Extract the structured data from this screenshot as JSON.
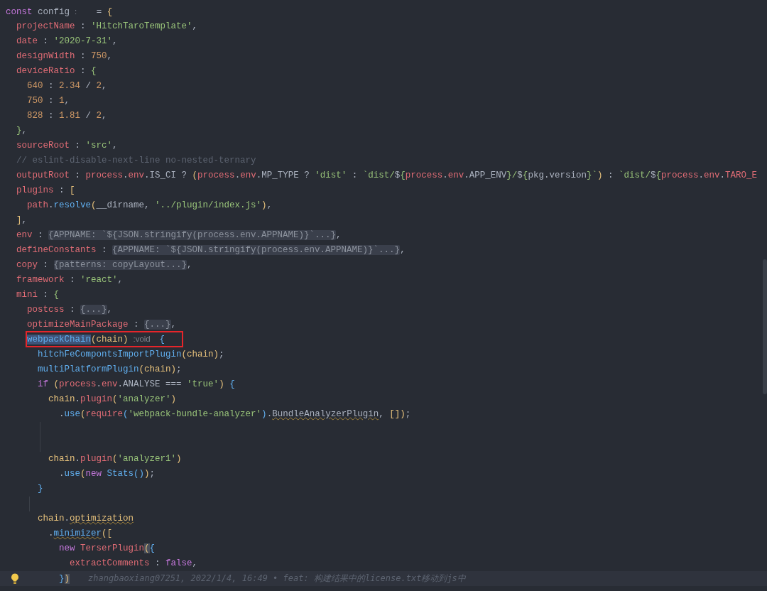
{
  "code_lines": [
    {
      "tokens": [
        {
          "kind": "kw",
          "text": "const"
        },
        {
          "kind": "p",
          "text": " config"
        },
        {
          "kind": "hint",
          "text": ":"
        },
        {
          "kind": "p",
          "text": "  = "
        },
        {
          "kind": "brk",
          "text": "{"
        }
      ],
      "children": [
        {
          "tokens": [
            {
              "kind": "prop",
              "text": "projectName"
            },
            {
              "kind": "p",
              "text": " : "
            },
            {
              "kind": "str",
              "text": "'HitchTaroTemplate'"
            },
            {
              "kind": "p",
              "text": ","
            }
          ]
        },
        {
          "tokens": [
            {
              "kind": "prop",
              "text": "date"
            },
            {
              "kind": "p",
              "text": " : "
            },
            {
              "kind": "str",
              "text": "'2020-7-31'"
            },
            {
              "kind": "p",
              "text": ","
            }
          ]
        },
        {
          "tokens": [
            {
              "kind": "prop",
              "text": "designWidth"
            },
            {
              "kind": "p",
              "text": " : "
            },
            {
              "kind": "num",
              "text": "750"
            },
            {
              "kind": "p",
              "text": ","
            }
          ]
        },
        {
          "tokens": [
            {
              "kind": "prop",
              "text": "deviceRatio"
            },
            {
              "kind": "p",
              "text": " : "
            },
            {
              "kind": "brg",
              "text": "{"
            }
          ],
          "children": [
            {
              "tokens": [
                {
                  "kind": "num",
                  "text": "640"
                },
                {
                  "kind": "p",
                  "text": " : "
                },
                {
                  "kind": "num",
                  "text": "2.34"
                },
                {
                  "kind": "p",
                  "text": " / "
                },
                {
                  "kind": "num",
                  "text": "2"
                },
                {
                  "kind": "p",
                  "text": ","
                }
              ]
            },
            {
              "tokens": [
                {
                  "kind": "num",
                  "text": "750"
                },
                {
                  "kind": "p",
                  "text": " : "
                },
                {
                  "kind": "num",
                  "text": "1"
                },
                {
                  "kind": "p",
                  "text": ","
                }
              ]
            },
            {
              "tokens": [
                {
                  "kind": "num",
                  "text": "828"
                },
                {
                  "kind": "p",
                  "text": " : "
                },
                {
                  "kind": "num",
                  "text": "1.81"
                },
                {
                  "kind": "p",
                  "text": " / "
                },
                {
                  "kind": "num",
                  "text": "2"
                },
                {
                  "kind": "p",
                  "text": ","
                }
              ]
            }
          ]
        },
        {
          "tokens": [
            {
              "kind": "brg",
              "text": "}"
            },
            {
              "kind": "p",
              "text": ","
            }
          ]
        },
        {
          "tokens": [
            {
              "kind": "prop",
              "text": "sourceRoot"
            },
            {
              "kind": "p",
              "text": " : "
            },
            {
              "kind": "str",
              "text": "'src'"
            },
            {
              "kind": "p",
              "text": ","
            }
          ]
        },
        {
          "tokens": [
            {
              "kind": "cmt",
              "text": "// eslint-disable-next-line no-nested-ternary"
            }
          ]
        },
        {
          "tokens": [
            {
              "kind": "prop",
              "text": "outputRoot"
            },
            {
              "kind": "p",
              "text": " : "
            },
            {
              "kind": "prop",
              "text": "process"
            },
            {
              "kind": "p",
              "text": "."
            },
            {
              "kind": "prop",
              "text": "env"
            },
            {
              "kind": "p",
              "text": ".IS_CI ? "
            },
            {
              "kind": "brk",
              "text": "("
            },
            {
              "kind": "prop",
              "text": "process"
            },
            {
              "kind": "p",
              "text": "."
            },
            {
              "kind": "prop",
              "text": "env"
            },
            {
              "kind": "p",
              "text": ".MP_TYPE ? "
            },
            {
              "kind": "str",
              "text": "'dist'"
            },
            {
              "kind": "p",
              "text": " : "
            },
            {
              "kind": "str",
              "text": "`dist/"
            },
            {
              "kind": "p",
              "text": "$"
            },
            {
              "kind": "brg",
              "text": "{"
            },
            {
              "kind": "prop",
              "text": "process"
            },
            {
              "kind": "p",
              "text": "."
            },
            {
              "kind": "prop",
              "text": "env"
            },
            {
              "kind": "p",
              "text": ".APP_ENV"
            },
            {
              "kind": "brg",
              "text": "}"
            },
            {
              "kind": "str",
              "text": "/"
            },
            {
              "kind": "p",
              "text": "$"
            },
            {
              "kind": "brg",
              "text": "{"
            },
            {
              "kind": "p",
              "text": "pkg.version"
            },
            {
              "kind": "brg",
              "text": "}"
            },
            {
              "kind": "str",
              "text": "`"
            },
            {
              "kind": "brk",
              "text": ")"
            },
            {
              "kind": "p",
              "text": " : "
            },
            {
              "kind": "str",
              "text": "`dist/"
            },
            {
              "kind": "p",
              "text": "$"
            },
            {
              "kind": "brg",
              "text": "{"
            },
            {
              "kind": "prop",
              "text": "process"
            },
            {
              "kind": "p",
              "text": "."
            },
            {
              "kind": "prop",
              "text": "env"
            },
            {
              "kind": "p",
              "text": "."
            },
            {
              "kind": "prop",
              "text": "TARO_E"
            }
          ]
        },
        {
          "tokens": [
            {
              "kind": "prop",
              "text": "plugins"
            },
            {
              "kind": "p",
              "text": " : "
            },
            {
              "kind": "brk",
              "text": "["
            }
          ],
          "children": [
            {
              "tokens": [
                {
                  "kind": "prop",
                  "text": "path"
                },
                {
                  "kind": "p",
                  "text": "."
                },
                {
                  "kind": "fn",
                  "text": "resolve"
                },
                {
                  "kind": "brk",
                  "text": "("
                },
                {
                  "kind": "p",
                  "text": "__dirname, "
                },
                {
                  "kind": "str",
                  "text": "'../plugin/index.js'"
                },
                {
                  "kind": "brk",
                  "text": ")"
                },
                {
                  "kind": "p",
                  "text": ","
                }
              ]
            }
          ]
        },
        {
          "tokens": [
            {
              "kind": "brk",
              "text": "]"
            },
            {
              "kind": "p",
              "text": ","
            }
          ]
        },
        {
          "tokens": [
            {
              "kind": "prop",
              "text": "env"
            },
            {
              "kind": "p",
              "text": " : "
            },
            {
              "kind": "fold",
              "text": "{APPNAME: `${JSON.stringify(process.env.APPNAME)}`...}"
            },
            {
              "kind": "p",
              "text": ","
            }
          ]
        },
        {
          "tokens": [
            {
              "kind": "prop",
              "text": "defineConstants"
            },
            {
              "kind": "p",
              "text": " : "
            },
            {
              "kind": "fold",
              "text": "{APPNAME: `${JSON.stringify(process.env.APPNAME)}`...}"
            },
            {
              "kind": "p",
              "text": ","
            }
          ]
        },
        {
          "tokens": [
            {
              "kind": "prop",
              "text": "copy"
            },
            {
              "kind": "p",
              "text": " : "
            },
            {
              "kind": "fold",
              "text": "{patterns: copyLayout...}"
            },
            {
              "kind": "p",
              "text": ","
            }
          ]
        },
        {
          "tokens": [
            {
              "kind": "prop",
              "text": "framework"
            },
            {
              "kind": "p",
              "text": " : "
            },
            {
              "kind": "str",
              "text": "'react'"
            },
            {
              "kind": "p",
              "text": ","
            }
          ]
        },
        {
          "tokens": [
            {
              "kind": "prop",
              "text": "mini"
            },
            {
              "kind": "p",
              "text": " : "
            },
            {
              "kind": "brg",
              "text": "{"
            }
          ],
          "children": [
            {
              "tokens": [
                {
                  "kind": "prop",
                  "text": "postcss"
                },
                {
                  "kind": "p",
                  "text": " : "
                },
                {
                  "kind": "fold",
                  "text": "{...}"
                },
                {
                  "kind": "p",
                  "text": ","
                }
              ]
            },
            {
              "tokens": [
                {
                  "kind": "prop",
                  "text": "optimizeMainPackage"
                },
                {
                  "kind": "p",
                  "text": " : "
                },
                {
                  "kind": "fold",
                  "text": "{...}"
                },
                {
                  "kind": "p",
                  "text": ","
                }
              ]
            },
            {
              "boxed": true,
              "tokens": [
                {
                  "kind": "sel",
                  "text": "webpackChain"
                },
                {
                  "kind": "brk",
                  "text": "("
                },
                {
                  "kind": "var",
                  "text": "chain"
                },
                {
                  "kind": "brk",
                  "text": ")"
                },
                {
                  "kind": "hint",
                  "text": ":void"
                },
                {
                  "kind": "brb",
                  "text": "{"
                }
              ],
              "children": [
                {
                  "tokens": [
                    {
                      "kind": "fn",
                      "text": "hitchFeCompontsImportPlugin"
                    },
                    {
                      "kind": "brk",
                      "text": "("
                    },
                    {
                      "kind": "var",
                      "text": "chain"
                    },
                    {
                      "kind": "brk",
                      "text": ")"
                    },
                    {
                      "kind": "p",
                      "text": ";"
                    }
                  ]
                },
                {
                  "tokens": [
                    {
                      "kind": "fn",
                      "text": "multiPlatformPlugin"
                    },
                    {
                      "kind": "brk",
                      "text": "("
                    },
                    {
                      "kind": "var",
                      "text": "chain"
                    },
                    {
                      "kind": "brk",
                      "text": ")"
                    },
                    {
                      "kind": "p",
                      "text": ";"
                    }
                  ]
                },
                {
                  "tokens": [
                    {
                      "kind": "kw",
                      "text": "if"
                    },
                    {
                      "kind": "brk",
                      "text": " ("
                    },
                    {
                      "kind": "prop",
                      "text": "process"
                    },
                    {
                      "kind": "p",
                      "text": "."
                    },
                    {
                      "kind": "prop",
                      "text": "env"
                    },
                    {
                      "kind": "p",
                      "text": ".ANALYSE === "
                    },
                    {
                      "kind": "str",
                      "text": "'true'"
                    },
                    {
                      "kind": "brk",
                      "text": ")"
                    },
                    {
                      "kind": "brb",
                      "text": " {"
                    }
                  ],
                  "children": [
                    {
                      "tokens": [
                        {
                          "kind": "var",
                          "text": "chain"
                        },
                        {
                          "kind": "p",
                          "text": "."
                        },
                        {
                          "kind": "prop",
                          "text": "plugin"
                        },
                        {
                          "kind": "brk",
                          "text": "("
                        },
                        {
                          "kind": "str",
                          "text": "'analyzer'"
                        },
                        {
                          "kind": "brk",
                          "text": ")"
                        }
                      ],
                      "children": [
                        {
                          "tokens": [
                            {
                              "kind": "p",
                              "text": "."
                            },
                            {
                              "kind": "fn",
                              "text": "use"
                            },
                            {
                              "kind": "brk",
                              "text": "("
                            },
                            {
                              "kind": "prop",
                              "text": "require"
                            },
                            {
                              "kind": "brb",
                              "text": "("
                            },
                            {
                              "kind": "str",
                              "text": "'webpack-bundle-analyzer'"
                            },
                            {
                              "kind": "brb",
                              "text": ")"
                            },
                            {
                              "kind": "p",
                              "text": "."
                            },
                            {
                              "kind": "under",
                              "text": "BundleAnalyzerPlugin"
                            },
                            {
                              "kind": "p",
                              "text": ", "
                            },
                            {
                              "kind": "brk",
                              "text": "[]"
                            },
                            {
                              "kind": "brk",
                              "text": ")"
                            },
                            {
                              "kind": "p",
                              "text": ";"
                            }
                          ]
                        }
                      ]
                    },
                    {
                      "indent_guide": true
                    },
                    {
                      "indent_guide": true
                    },
                    {
                      "tokens": [
                        {
                          "kind": "var",
                          "text": "chain"
                        },
                        {
                          "kind": "p",
                          "text": "."
                        },
                        {
                          "kind": "prop",
                          "text": "plugin"
                        },
                        {
                          "kind": "brk",
                          "text": "("
                        },
                        {
                          "kind": "str",
                          "text": "'analyzer1'"
                        },
                        {
                          "kind": "brk",
                          "text": ")"
                        }
                      ],
                      "children": [
                        {
                          "tokens": [
                            {
                              "kind": "p",
                              "text": "."
                            },
                            {
                              "kind": "fn",
                              "text": "use"
                            },
                            {
                              "kind": "brk",
                              "text": "("
                            },
                            {
                              "kind": "kw",
                              "text": "new"
                            },
                            {
                              "kind": "fn",
                              "text": " Stats"
                            },
                            {
                              "kind": "brb",
                              "text": "()"
                            },
                            {
                              "kind": "brk",
                              "text": ")"
                            },
                            {
                              "kind": "p",
                              "text": ";"
                            }
                          ]
                        }
                      ]
                    }
                  ]
                },
                {
                  "tokens": [
                    {
                      "kind": "brb",
                      "text": "}"
                    }
                  ]
                },
                {
                  "indent_guide": true
                },
                {
                  "tokens": [
                    {
                      "kind": "var",
                      "text": "chain"
                    },
                    {
                      "kind": "p",
                      "text": "."
                    },
                    {
                      "kind": "varu",
                      "text": "optimization"
                    }
                  ],
                  "children": [
                    {
                      "tokens": [
                        {
                          "kind": "p",
                          "text": "."
                        },
                        {
                          "kind": "fnu",
                          "text": "minimizer"
                        },
                        {
                          "kind": "brk",
                          "text": "(["
                        }
                      ],
                      "children": [
                        {
                          "tokens": [
                            {
                              "kind": "kw",
                              "text": "new"
                            },
                            {
                              "kind": "prop",
                              "text": " TerserPlugin"
                            },
                            {
                              "kind": "match",
                              "text": "("
                            },
                            {
                              "kind": "brb",
                              "text": "{"
                            }
                          ],
                          "children": [
                            {
                              "tokens": [
                                {
                                  "kind": "prop",
                                  "text": "extractComments"
                                },
                                {
                                  "kind": "p",
                                  "text": " : "
                                },
                                {
                                  "kind": "kw",
                                  "text": "false"
                                },
                                {
                                  "kind": "p",
                                  "text": ","
                                }
                              ]
                            }
                          ]
                        },
                        {
                          "current": true,
                          "bulb": true,
                          "blame": "zhangbaoxiang07251, 2022/1/4, 16:49 • feat: 构建结果中的license.txt移动到js中",
                          "tokens": [
                            {
                              "kind": "brb",
                              "text": "}"
                            },
                            {
                              "kind": "match",
                              "text": ")"
                            }
                          ]
                        }
                      ]
                    }
                  ]
                }
              ]
            }
          ]
        }
      ]
    }
  ]
}
